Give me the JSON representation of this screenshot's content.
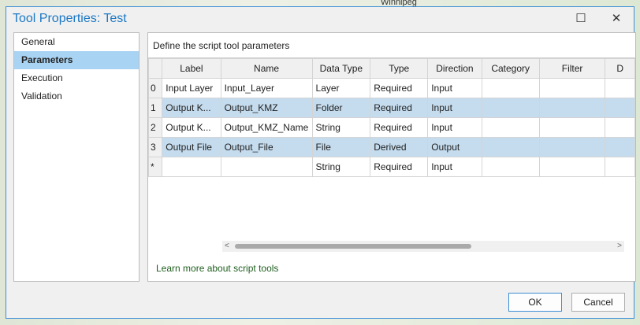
{
  "background": {
    "map_label": "Winnipeg"
  },
  "dialog": {
    "title": "Tool Properties: Test",
    "maximize": "☐",
    "close": "✕"
  },
  "nav": {
    "items": [
      {
        "label": "General"
      },
      {
        "label": "Parameters"
      },
      {
        "label": "Execution"
      },
      {
        "label": "Validation"
      }
    ]
  },
  "panel": {
    "description": "Define the script tool parameters",
    "columns": [
      "",
      "Label",
      "Name",
      "Data Type",
      "Type",
      "Direction",
      "Category",
      "Filter",
      "D"
    ],
    "rows": [
      [
        "0",
        "Input Layer",
        "Input_Layer",
        "Layer",
        "Required",
        "Input",
        "",
        "",
        ""
      ],
      [
        "1",
        "Output K...",
        "Output_KMZ",
        "Folder",
        "Required",
        "Input",
        "",
        "",
        ""
      ],
      [
        "2",
        "Output K...",
        "Output_KMZ_Name",
        "String",
        "Required",
        "Input",
        "",
        "",
        ""
      ],
      [
        "3",
        "Output File",
        "Output_File",
        "File",
        "Derived",
        "Output",
        "",
        "",
        ""
      ],
      [
        "*",
        "",
        "",
        "String",
        "Required",
        "Input",
        "",
        "",
        ""
      ]
    ],
    "link": "Learn more about script tools"
  },
  "buttons": {
    "ok": "OK",
    "cancel": "Cancel"
  }
}
